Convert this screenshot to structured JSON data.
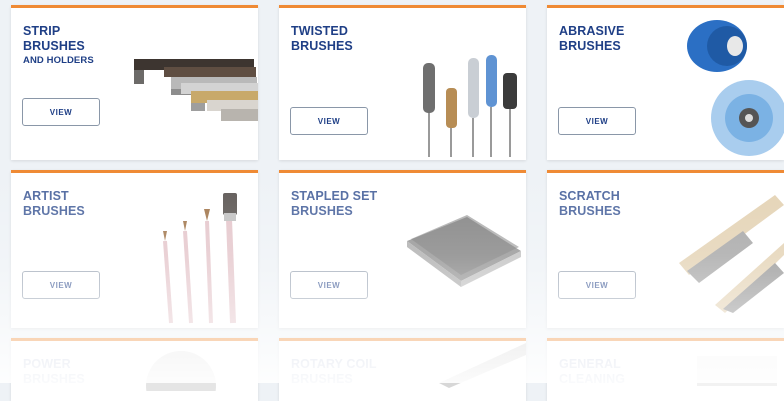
{
  "colors": {
    "accent": "#ef8a34",
    "title": "#1f3f86",
    "button_border": "#8a97a8"
  },
  "cards": [
    {
      "title_line1": "STRIP",
      "title_line2": "BRUSHES",
      "title_line3": "AND HOLDERS",
      "button": "VIEW",
      "icon": "strip-brushes-image"
    },
    {
      "title_line1": "TWISTED",
      "title_line2": "BRUSHES",
      "button": "VIEW",
      "icon": "twisted-brushes-image"
    },
    {
      "title_line1": "ABRASIVE",
      "title_line2": "BRUSHES",
      "button": "VIEW",
      "icon": "abrasive-brushes-image"
    },
    {
      "title_line1": "ARTIST",
      "title_line2": "BRUSHES",
      "button": "VIEW",
      "icon": "artist-brushes-image"
    },
    {
      "title_line1": "STAPLED SET",
      "title_line2": "BRUSHES",
      "button": "VIEW",
      "icon": "stapled-set-brushes-image"
    },
    {
      "title_line1": "SCRATCH",
      "title_line2": "BRUSHES",
      "button": "VIEW",
      "icon": "scratch-brushes-image"
    },
    {
      "title_line1": "POWER",
      "title_line2": "BRUSHES",
      "icon": "power-brushes-image"
    },
    {
      "title_line1": "ROTARY COIL",
      "title_line2": "BRUSHES",
      "icon": "rotary-coil-brushes-image"
    },
    {
      "title_line1": "GENERAL",
      "title_line2": "CLEANING",
      "icon": "general-cleaning-image"
    }
  ]
}
